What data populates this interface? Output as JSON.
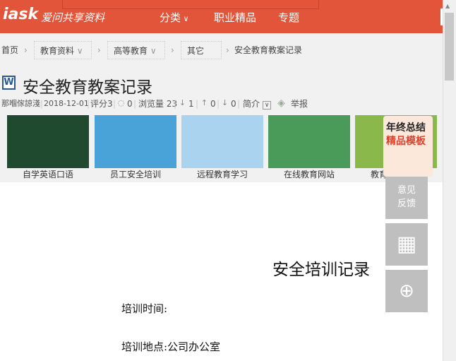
{
  "header": {
    "logo": "iask",
    "logo_sub": "爱问共享资料",
    "nav": [
      {
        "label": "分类",
        "icon": "chevron-down-icon"
      },
      {
        "label": "职业精品"
      },
      {
        "label": "专题"
      }
    ]
  },
  "breadcrumb": {
    "items": [
      "首页",
      "教育资料",
      "高等教育",
      "其它",
      "安全教育教案记录"
    ]
  },
  "doc": {
    "title": "安全教育教案记录",
    "file_type_icon": "word-icon",
    "author": "那嗰傢諒淺",
    "date": "2018-12-01",
    "rating": "评分3",
    "comments": "0",
    "views": "浏览量 23",
    "downloads": "1",
    "likes": "0",
    "dislikes": "0",
    "summary": "简介",
    "report": "举报"
  },
  "related": [
    {
      "label": "自学英语口语",
      "color": "#1f4a30"
    },
    {
      "label": "员工安全培训",
      "color": "#4aa3d8"
    },
    {
      "label": "远程教育学习",
      "color": "#a9d3ee"
    },
    {
      "label": "在线教育网站",
      "color": "#4a9a5a"
    },
    {
      "label": "教育平台公司",
      "color": "#8bb84a"
    }
  ],
  "ad": {
    "line1": "年终总结",
    "line2": "精品模板"
  },
  "float": {
    "feedback": "意见反馈",
    "qr_icon": "qr-code-icon",
    "shield_icon": "shield-plus-icon"
  },
  "page": {
    "heading": "安全培训记录",
    "line1": "培训时间:",
    "line2": "培训地点:公司办公室"
  }
}
